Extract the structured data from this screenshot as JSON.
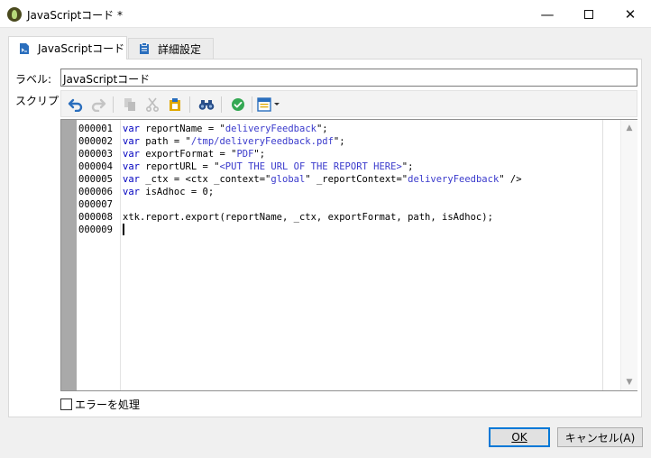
{
  "window": {
    "title": "JavaScriptコード *",
    "minimize_glyph": "—",
    "close_glyph": "✕"
  },
  "tabs": [
    {
      "label": "JavaScriptコード",
      "active": true
    },
    {
      "label": "詳細設定",
      "active": false
    }
  ],
  "form": {
    "label_caption": "ラベル:",
    "label_value": "JavaScriptコード",
    "script_caption": "スクリプト:"
  },
  "toolbar": {
    "icons": [
      "undo-icon",
      "redo-icon",
      "copy-icon",
      "cut-icon",
      "paste-icon",
      "find-icon",
      "check-icon",
      "template-menu-icon"
    ]
  },
  "editor": {
    "line_numbers": [
      "000001",
      "000002",
      "000003",
      "000004",
      "000005",
      "000006",
      "000007",
      "000008",
      "000009"
    ],
    "lines": [
      "var reportName = \"deliveryFeedback\";",
      "var path = \"/tmp/deliveryFeedback.pdf\";",
      "var exportFormat = \"PDF\";",
      "var reportURL = \"<PUT THE URL OF THE REPORT HERE>\";",
      "var _ctx = <ctx _context=\"global\" _reportContext=\"deliveryFeedback\" />",
      "var isAdhoc = 0;",
      "",
      "xtk.report.export(reportName, _ctx, exportFormat, path, isAdhoc);",
      ""
    ],
    "keyword_color": "#0000c0",
    "string_color": "#3a3acc"
  },
  "options": {
    "handle_errors_label": "エラーを処理",
    "handle_errors_checked": false
  },
  "buttons": {
    "ok_label": "OK",
    "cancel_label": "キャンセル(A)"
  },
  "colors": {
    "accent": "#0078d7",
    "gutter": "#a9a9a9"
  }
}
